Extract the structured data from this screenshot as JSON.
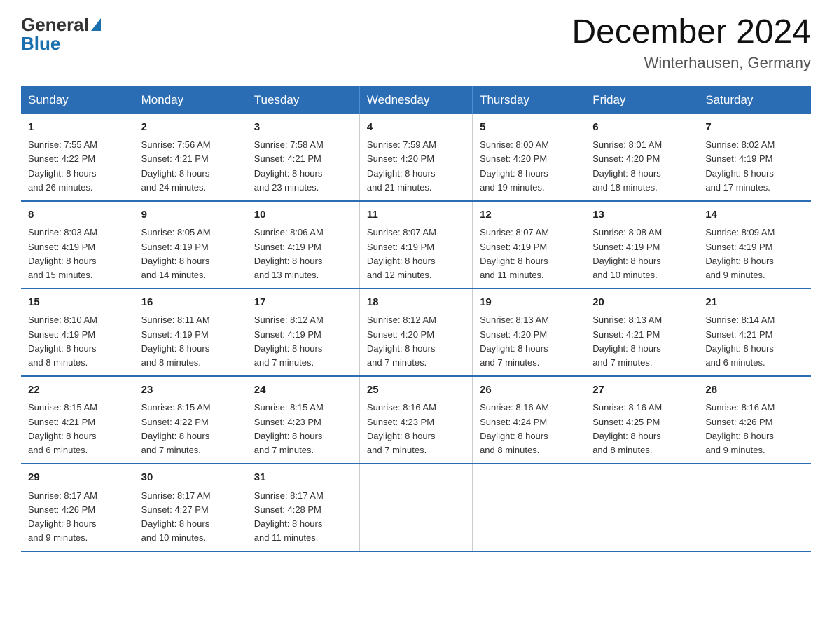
{
  "header": {
    "logo_general": "General",
    "logo_blue": "Blue",
    "month_title": "December 2024",
    "location": "Winterhausen, Germany"
  },
  "days_of_week": [
    "Sunday",
    "Monday",
    "Tuesday",
    "Wednesday",
    "Thursday",
    "Friday",
    "Saturday"
  ],
  "weeks": [
    [
      {
        "day": "1",
        "sunrise": "7:55 AM",
        "sunset": "4:22 PM",
        "daylight": "8 hours and 26 minutes."
      },
      {
        "day": "2",
        "sunrise": "7:56 AM",
        "sunset": "4:21 PM",
        "daylight": "8 hours and 24 minutes."
      },
      {
        "day": "3",
        "sunrise": "7:58 AM",
        "sunset": "4:21 PM",
        "daylight": "8 hours and 23 minutes."
      },
      {
        "day": "4",
        "sunrise": "7:59 AM",
        "sunset": "4:20 PM",
        "daylight": "8 hours and 21 minutes."
      },
      {
        "day": "5",
        "sunrise": "8:00 AM",
        "sunset": "4:20 PM",
        "daylight": "8 hours and 19 minutes."
      },
      {
        "day": "6",
        "sunrise": "8:01 AM",
        "sunset": "4:20 PM",
        "daylight": "8 hours and 18 minutes."
      },
      {
        "day": "7",
        "sunrise": "8:02 AM",
        "sunset": "4:19 PM",
        "daylight": "8 hours and 17 minutes."
      }
    ],
    [
      {
        "day": "8",
        "sunrise": "8:03 AM",
        "sunset": "4:19 PM",
        "daylight": "8 hours and 15 minutes."
      },
      {
        "day": "9",
        "sunrise": "8:05 AM",
        "sunset": "4:19 PM",
        "daylight": "8 hours and 14 minutes."
      },
      {
        "day": "10",
        "sunrise": "8:06 AM",
        "sunset": "4:19 PM",
        "daylight": "8 hours and 13 minutes."
      },
      {
        "day": "11",
        "sunrise": "8:07 AM",
        "sunset": "4:19 PM",
        "daylight": "8 hours and 12 minutes."
      },
      {
        "day": "12",
        "sunrise": "8:07 AM",
        "sunset": "4:19 PM",
        "daylight": "8 hours and 11 minutes."
      },
      {
        "day": "13",
        "sunrise": "8:08 AM",
        "sunset": "4:19 PM",
        "daylight": "8 hours and 10 minutes."
      },
      {
        "day": "14",
        "sunrise": "8:09 AM",
        "sunset": "4:19 PM",
        "daylight": "8 hours and 9 minutes."
      }
    ],
    [
      {
        "day": "15",
        "sunrise": "8:10 AM",
        "sunset": "4:19 PM",
        "daylight": "8 hours and 8 minutes."
      },
      {
        "day": "16",
        "sunrise": "8:11 AM",
        "sunset": "4:19 PM",
        "daylight": "8 hours and 8 minutes."
      },
      {
        "day": "17",
        "sunrise": "8:12 AM",
        "sunset": "4:19 PM",
        "daylight": "8 hours and 7 minutes."
      },
      {
        "day": "18",
        "sunrise": "8:12 AM",
        "sunset": "4:20 PM",
        "daylight": "8 hours and 7 minutes."
      },
      {
        "day": "19",
        "sunrise": "8:13 AM",
        "sunset": "4:20 PM",
        "daylight": "8 hours and 7 minutes."
      },
      {
        "day": "20",
        "sunrise": "8:13 AM",
        "sunset": "4:21 PM",
        "daylight": "8 hours and 7 minutes."
      },
      {
        "day": "21",
        "sunrise": "8:14 AM",
        "sunset": "4:21 PM",
        "daylight": "8 hours and 6 minutes."
      }
    ],
    [
      {
        "day": "22",
        "sunrise": "8:15 AM",
        "sunset": "4:21 PM",
        "daylight": "8 hours and 6 minutes."
      },
      {
        "day": "23",
        "sunrise": "8:15 AM",
        "sunset": "4:22 PM",
        "daylight": "8 hours and 7 minutes."
      },
      {
        "day": "24",
        "sunrise": "8:15 AM",
        "sunset": "4:23 PM",
        "daylight": "8 hours and 7 minutes."
      },
      {
        "day": "25",
        "sunrise": "8:16 AM",
        "sunset": "4:23 PM",
        "daylight": "8 hours and 7 minutes."
      },
      {
        "day": "26",
        "sunrise": "8:16 AM",
        "sunset": "4:24 PM",
        "daylight": "8 hours and 8 minutes."
      },
      {
        "day": "27",
        "sunrise": "8:16 AM",
        "sunset": "4:25 PM",
        "daylight": "8 hours and 8 minutes."
      },
      {
        "day": "28",
        "sunrise": "8:16 AM",
        "sunset": "4:26 PM",
        "daylight": "8 hours and 9 minutes."
      }
    ],
    [
      {
        "day": "29",
        "sunrise": "8:17 AM",
        "sunset": "4:26 PM",
        "daylight": "8 hours and 9 minutes."
      },
      {
        "day": "30",
        "sunrise": "8:17 AM",
        "sunset": "4:27 PM",
        "daylight": "8 hours and 10 minutes."
      },
      {
        "day": "31",
        "sunrise": "8:17 AM",
        "sunset": "4:28 PM",
        "daylight": "8 hours and 11 minutes."
      },
      null,
      null,
      null,
      null
    ]
  ],
  "labels": {
    "sunrise": "Sunrise:",
    "sunset": "Sunset:",
    "daylight": "Daylight:"
  }
}
